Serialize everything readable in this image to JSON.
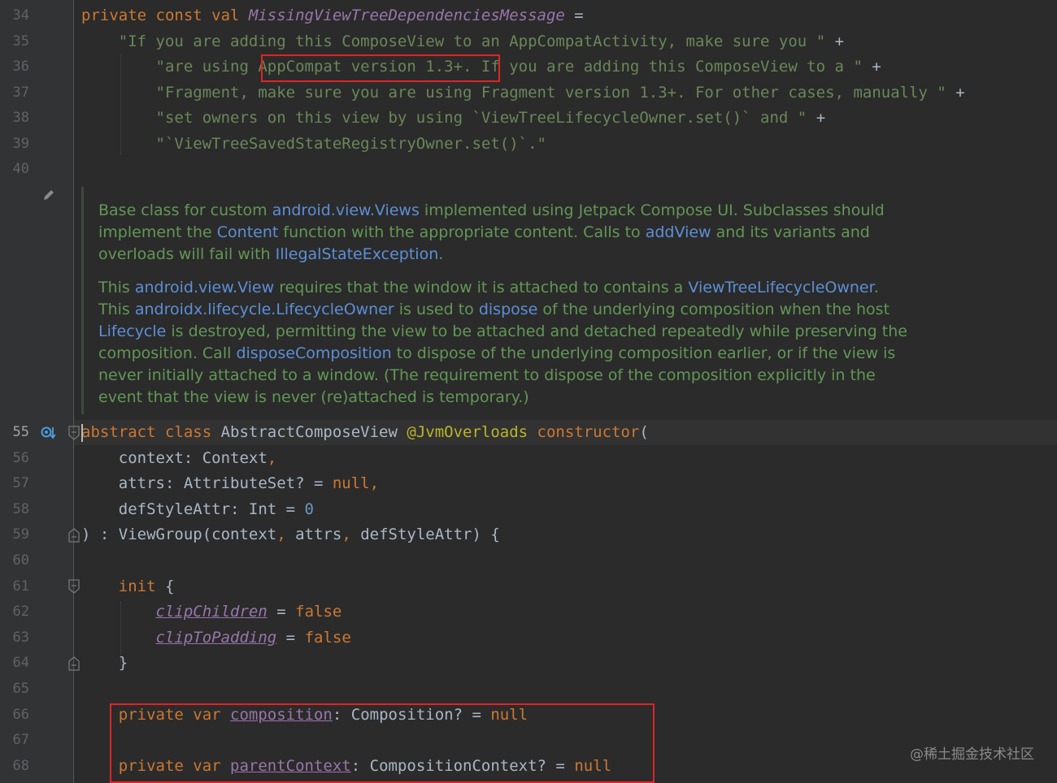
{
  "lines": [
    {
      "num": "34",
      "parts": [
        [
          "kw",
          "private const val "
        ],
        [
          "ital",
          "MissingViewTreeDependenciesMessage"
        ],
        [
          "plain",
          " ="
        ]
      ]
    },
    {
      "num": "35",
      "parts": [
        [
          "plain",
          "    "
        ],
        [
          "str",
          "\"If you are adding this ComposeView to an AppCompatActivity, make sure you \""
        ],
        [
          "plain",
          " +"
        ]
      ]
    },
    {
      "num": "36",
      "parts": [
        [
          "plain",
          "        "
        ],
        [
          "str",
          "\"are using AppCompat version 1.3+. If you are adding this ComposeView to a \""
        ],
        [
          "plain",
          " +"
        ]
      ]
    },
    {
      "num": "37",
      "parts": [
        [
          "plain",
          "        "
        ],
        [
          "str",
          "\"Fragment, make sure you are using Fragment version 1.3+. For other cases, manually \""
        ],
        [
          "plain",
          " +"
        ]
      ]
    },
    {
      "num": "38",
      "parts": [
        [
          "plain",
          "        "
        ],
        [
          "str",
          "\"set owners on this view by using `ViewTreeLifecycleOwner.set()` and \""
        ],
        [
          "plain",
          " +"
        ]
      ]
    },
    {
      "num": "39",
      "parts": [
        [
          "plain",
          "        "
        ],
        [
          "str",
          "\"`ViewTreeSavedStateRegistryOwner.set()`.\""
        ]
      ]
    },
    {
      "num": "40",
      "parts": []
    }
  ],
  "doc_paragraphs": [
    [
      [
        "t",
        "Base class for custom "
      ],
      [
        "l",
        "android.view.Views"
      ],
      [
        "t",
        " implemented using Jetpack Compose UI. Subclasses should implement the "
      ],
      [
        "l",
        "Content"
      ],
      [
        "t",
        " function with the appropriate content. Calls to "
      ],
      [
        "l",
        "addView"
      ],
      [
        "t",
        " and its variants and overloads will fail with "
      ],
      [
        "l",
        "IllegalStateException"
      ],
      [
        "t",
        "."
      ]
    ],
    [
      [
        "t",
        "This "
      ],
      [
        "l",
        "android.view.View"
      ],
      [
        "t",
        " requires that the window it is attached to contains a "
      ],
      [
        "l",
        "ViewTreeLifecycleOwner"
      ],
      [
        "t",
        ". This "
      ],
      [
        "l",
        "androidx.lifecycle.LifecycleOwner"
      ],
      [
        "t",
        " is used to "
      ],
      [
        "l",
        "dispose"
      ],
      [
        "t",
        " of the underlying composition when the host "
      ],
      [
        "l",
        "Lifecycle"
      ],
      [
        "t",
        " is destroyed, permitting the view to be attached and detached repeatedly while preserving the composition. Call "
      ],
      [
        "l",
        "disposeComposition"
      ],
      [
        "t",
        " to dispose of the underlying composition earlier, or if the view is never initially attached to a window. (The requirement to dispose of the composition explicitly in the event that the view is never (re)attached is temporary.)"
      ]
    ]
  ],
  "lines2": [
    {
      "num": "55",
      "parts": [
        [
          "kw",
          "abstract class "
        ],
        [
          "plain",
          "AbstractComposeView "
        ],
        [
          "ann",
          "@JvmOverloads "
        ],
        [
          "kw",
          "constructor"
        ],
        [
          "plain",
          "("
        ]
      ]
    },
    {
      "num": "56",
      "parts": [
        [
          "plain",
          "    context: Context"
        ],
        [
          "kw",
          ","
        ]
      ]
    },
    {
      "num": "57",
      "parts": [
        [
          "plain",
          "    attrs: AttributeSet? = "
        ],
        [
          "kw",
          "null,"
        ]
      ]
    },
    {
      "num": "58",
      "parts": [
        [
          "plain",
          "    defStyleAttr: Int = "
        ],
        [
          "num",
          "0"
        ]
      ]
    },
    {
      "num": "59",
      "parts": [
        [
          "plain",
          ") : ViewGroup(context"
        ],
        [
          "kw",
          ", "
        ],
        [
          "plain",
          "attrs"
        ],
        [
          "kw",
          ", "
        ],
        [
          "plain",
          "defStyleAttr) {"
        ]
      ]
    },
    {
      "num": "60",
      "parts": []
    },
    {
      "num": "61",
      "parts": [
        [
          "plain",
          "    "
        ],
        [
          "kw",
          "init "
        ],
        [
          "plain",
          "{"
        ]
      ]
    },
    {
      "num": "62",
      "parts": [
        [
          "plain",
          "        "
        ],
        [
          "iprop",
          "clipChildren"
        ],
        [
          "plain",
          " = "
        ],
        [
          "kw",
          "false"
        ]
      ]
    },
    {
      "num": "63",
      "parts": [
        [
          "plain",
          "        "
        ],
        [
          "iprop",
          "clipToPadding"
        ],
        [
          "plain",
          " = "
        ],
        [
          "kw",
          "false"
        ]
      ]
    },
    {
      "num": "64",
      "parts": [
        [
          "plain",
          "    }"
        ]
      ]
    },
    {
      "num": "65",
      "parts": []
    },
    {
      "num": "66",
      "parts": [
        [
          "plain",
          "    "
        ],
        [
          "kw",
          "private var "
        ],
        [
          "prop",
          "composition"
        ],
        [
          "plain",
          ": Composition? = "
        ],
        [
          "kw",
          "null"
        ]
      ]
    },
    {
      "num": "67",
      "parts": []
    },
    {
      "num": "68",
      "parts": [
        [
          "plain",
          "    "
        ],
        [
          "kw",
          "private var "
        ],
        [
          "prop",
          "parentContext"
        ],
        [
          "plain",
          ": CompositionContext? = "
        ],
        [
          "kw",
          "null"
        ]
      ]
    }
  ],
  "watermark": "@稀土掘金技术社区",
  "colors": {
    "bg": "#2b2b2b",
    "keyword": "#cc7832",
    "string": "#6a8759",
    "doc": "#629755",
    "link": "#5c8fd6",
    "highlight": "#e02424"
  }
}
